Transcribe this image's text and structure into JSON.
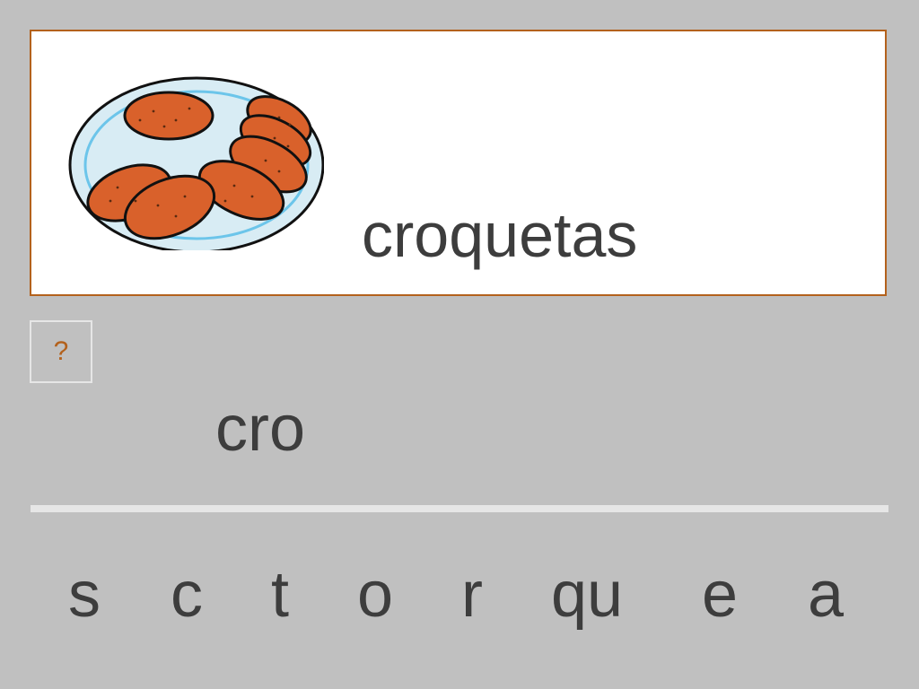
{
  "target_word": "croquetas",
  "image_icon": "plate-of-croquettes-icon",
  "hint_label": "?",
  "answer_text": "cro",
  "syllable_tiles": [
    "s",
    "c",
    "t",
    "o",
    "r",
    "qu",
    "e",
    "a"
  ],
  "colors": {
    "background": "#c0c0c0",
    "card_border": "#b3611c",
    "text": "#3d3d3d",
    "croquette_fill": "#d9612b",
    "plate_rim": "#6cc5ea",
    "plate_fill": "#d8ecf4"
  }
}
